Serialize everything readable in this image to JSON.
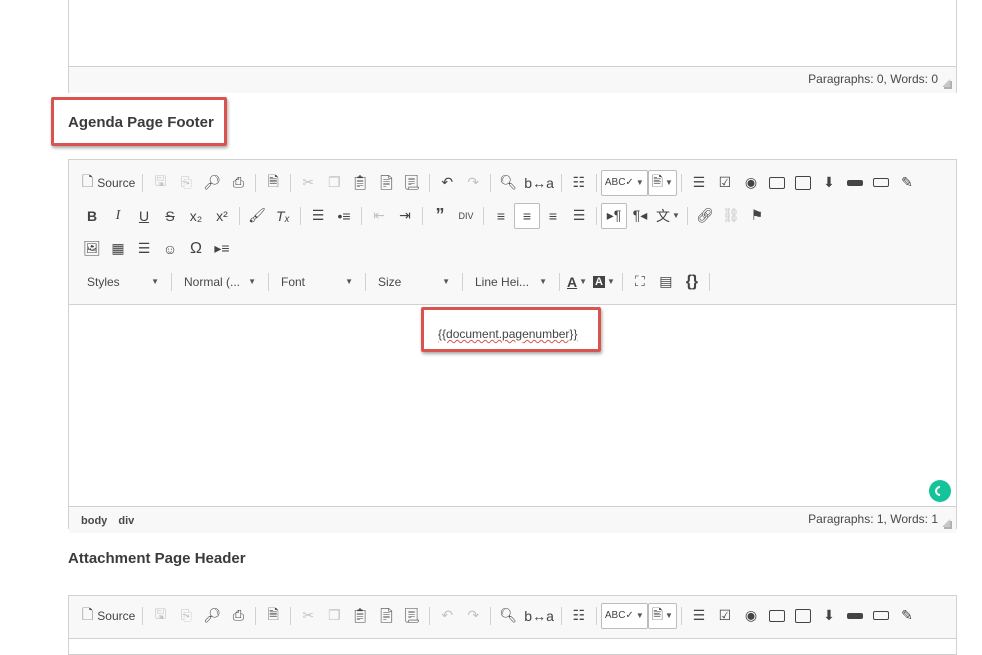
{
  "top_editor": {
    "status": "Paragraphs: 0, Words: 0"
  },
  "agenda_footer": {
    "title": "Agenda Page Footer",
    "toolbar": {
      "source_label": "Source",
      "styles": "Styles",
      "format": "Normal (...",
      "font": "Font",
      "size": "Size",
      "line_height": "Line Hei..."
    },
    "content_text": "{{document.pagenumber}}",
    "path": [
      "body",
      "div"
    ],
    "status": "Paragraphs: 1, Words: 1"
  },
  "attachment_header": {
    "title": "Attachment Page Header",
    "toolbar": {
      "source_label": "Source"
    }
  },
  "colors": {
    "highlight": "#d9534f",
    "grammarly": "#15c39a",
    "toolbar_bg": "#f8f8f8",
    "border": "#d1d1d1"
  }
}
